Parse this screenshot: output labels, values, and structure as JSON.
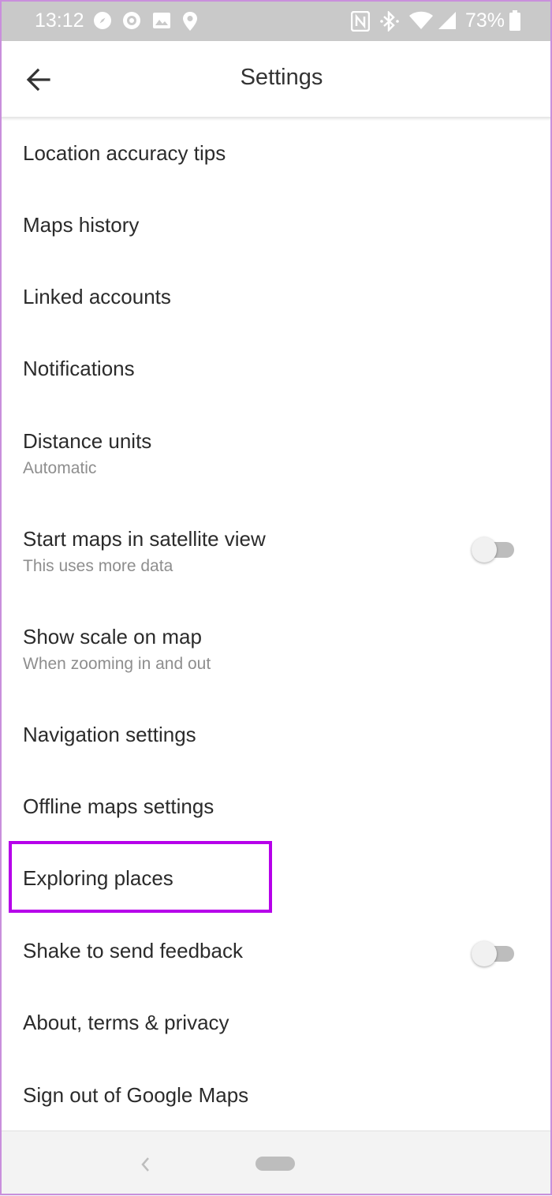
{
  "status_bar": {
    "time": "13:12",
    "battery": "73%",
    "icons": [
      "compass-icon",
      "target-icon",
      "image-icon",
      "location-pin-icon",
      "nfc-icon",
      "bluetooth-icon",
      "wifi-icon",
      "signal-icon",
      "battery-icon"
    ]
  },
  "app_bar": {
    "title": "Settings",
    "back_icon": "arrow-back-icon"
  },
  "settings": {
    "location_accuracy": {
      "title": "Location accuracy tips"
    },
    "maps_history": {
      "title": "Maps history"
    },
    "linked_accounts": {
      "title": "Linked accounts"
    },
    "notifications": {
      "title": "Notifications"
    },
    "distance_units": {
      "title": "Distance units",
      "subtitle": "Automatic"
    },
    "satellite_view": {
      "title": "Start maps in satellite view",
      "subtitle": "This uses more data",
      "toggle_on": false
    },
    "show_scale": {
      "title": "Show scale on map",
      "subtitle": "When zooming in and out"
    },
    "navigation_settings": {
      "title": "Navigation settings"
    },
    "offline_maps": {
      "title": "Offline maps settings"
    },
    "exploring_places": {
      "title": "Exploring places",
      "highlighted": true
    },
    "shake_feedback": {
      "title": "Shake to send feedback",
      "toggle_on": false
    },
    "about": {
      "title": "About, terms & privacy"
    },
    "sign_out": {
      "title": "Sign out of Google Maps"
    }
  },
  "colors": {
    "status_bar": "#c9c9c9",
    "highlight_border": "#b600ea",
    "frame_border": "#c98fdc",
    "text_primary": "#2b2b2b",
    "text_secondary": "#8e8e8e"
  }
}
